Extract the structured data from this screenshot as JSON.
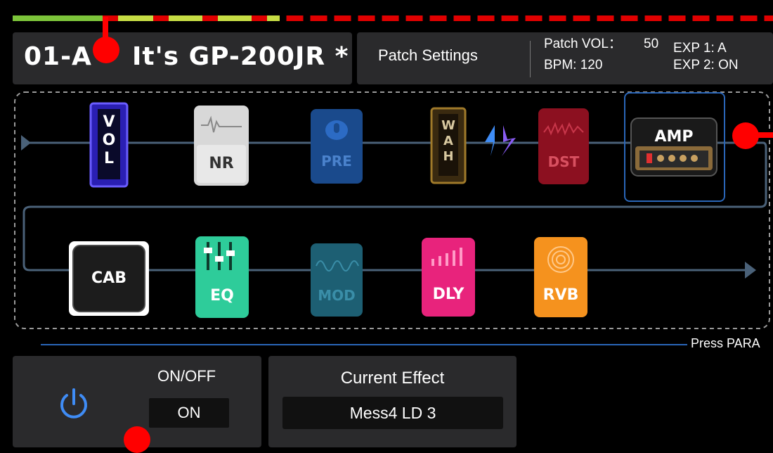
{
  "meter": {
    "level_fraction": 0.36,
    "colors": {
      "low": "#7cc43a",
      "mid": "#c6dc44",
      "clip": "#e00000"
    }
  },
  "header": {
    "patch_id": "01-A",
    "patch_title": "It's GP-200JR *",
    "settings_label": "Patch Settings",
    "patch_vol_label": "Patch VOL：",
    "patch_vol_value": "50",
    "bpm": "BPM: 120",
    "exp1": "EXP 1:  A",
    "exp2": "EXP 2: ON"
  },
  "chain": {
    "row1": [
      {
        "id": "vol",
        "label": "VOL",
        "color": "#2a1fb3",
        "selected": false
      },
      {
        "id": "nr",
        "label": "NR",
        "color": "#d4d4d4",
        "selected": false
      },
      {
        "id": "pre",
        "label": "PRE",
        "color": "#1a4a8c",
        "selected": false
      },
      {
        "id": "wah",
        "label": "WAH",
        "color": "#3a2a10",
        "selected": false
      },
      {
        "id": "dst",
        "label": "DST",
        "color": "#8c1020",
        "selected": false
      },
      {
        "id": "amp",
        "label": "AMP",
        "color": "#1a1a1a",
        "selected": true
      }
    ],
    "row2": [
      {
        "id": "cab",
        "label": "CAB",
        "color": "#1c1c1c",
        "selected": false
      },
      {
        "id": "eq",
        "label": "EQ",
        "color": "#2ecc9a",
        "selected": false
      },
      {
        "id": "mod",
        "label": "MOD",
        "color": "#1d5f73",
        "selected": false
      },
      {
        "id": "dly",
        "label": "DLY",
        "color": "#e8237c",
        "selected": false
      },
      {
        "id": "rvb",
        "label": "RVB",
        "color": "#f5921e",
        "selected": false
      }
    ]
  },
  "footer": {
    "hint": "Press PARA",
    "onoff_label": "ON/OFF",
    "onoff_value": "ON",
    "current_effect_label": "Current Effect",
    "current_effect_value": "Mess4 LD 3"
  },
  "colors": {
    "accent_blue": "#2a66b8",
    "panel": "#2a2a2c",
    "marker": "#ff0000"
  }
}
